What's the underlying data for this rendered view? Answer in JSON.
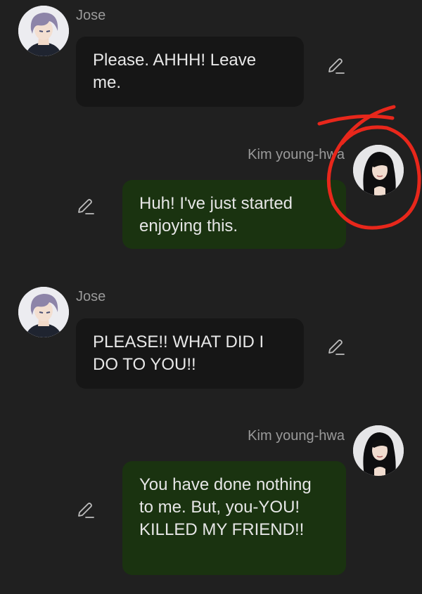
{
  "messages": [
    {
      "sender": "Jose",
      "text": "Please. AHHH! Leave me.",
      "side": "left",
      "edit_icon": "pencil-icon"
    },
    {
      "sender": "Kim young-hwa",
      "text": "Huh! I've just started enjoying this.",
      "side": "right",
      "edit_icon": "pencil-icon"
    },
    {
      "sender": "Jose",
      "text": "PLEASE!! WHAT DID I DO TO YOU!!",
      "side": "left",
      "edit_icon": "pencil-icon"
    },
    {
      "sender": "Kim young-hwa",
      "text": "You have done nothing to me. But, you-YOU! KILLED MY FRIEND!!",
      "side": "right",
      "edit_icon": "pencil-icon"
    }
  ],
  "colors": {
    "background": "#202020",
    "left_bubble": "#161616",
    "right_bubble": "#1a3310",
    "name_text": "#9a9a9a",
    "annotation": "#e8271b"
  }
}
